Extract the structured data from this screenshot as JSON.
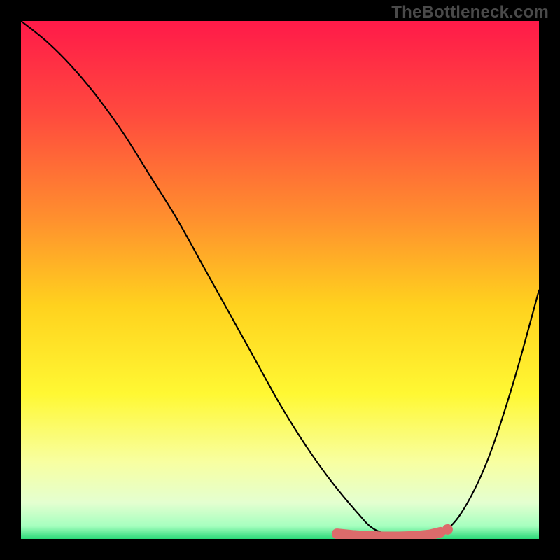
{
  "watermark": {
    "text": "TheBottleneck.com"
  },
  "colors": {
    "frame": "#000000",
    "marker": "#dc6b6b",
    "curve": "#000000",
    "gradient_stops": [
      {
        "offset": 0.0,
        "color": "#ff1a49"
      },
      {
        "offset": 0.18,
        "color": "#ff4a3e"
      },
      {
        "offset": 0.38,
        "color": "#ff8f2e"
      },
      {
        "offset": 0.55,
        "color": "#ffd21e"
      },
      {
        "offset": 0.72,
        "color": "#fff833"
      },
      {
        "offset": 0.85,
        "color": "#f8ffa0"
      },
      {
        "offset": 0.93,
        "color": "#e4ffd0"
      },
      {
        "offset": 0.975,
        "color": "#a6ffbf"
      },
      {
        "offset": 1.0,
        "color": "#2bd979"
      }
    ]
  },
  "chart_data": {
    "type": "line",
    "title": "",
    "xlabel": "",
    "ylabel": "",
    "xlim": [
      0,
      100
    ],
    "ylim": [
      0,
      100
    ],
    "grid": false,
    "legend": false,
    "series": [
      {
        "name": "bottleneck_curve",
        "x": [
          0,
          5,
          10,
          15,
          20,
          25,
          30,
          35,
          40,
          45,
          50,
          55,
          60,
          65,
          68,
          72,
          75,
          78,
          81,
          85,
          90,
          95,
          100
        ],
        "y": [
          100,
          96,
          91,
          85,
          78,
          70,
          62,
          53,
          44,
          35,
          26,
          18,
          11,
          5,
          2,
          0.5,
          0.3,
          0.4,
          1,
          5,
          15,
          30,
          48
        ]
      }
    ],
    "optimal_zone": {
      "comment": "flat bottom region highlighted by markers",
      "x": [
        61,
        64,
        67,
        70,
        73,
        76,
        79,
        81
      ],
      "y": [
        1,
        0.7,
        0.5,
        0.4,
        0.4,
        0.5,
        0.8,
        1.3
      ]
    }
  }
}
